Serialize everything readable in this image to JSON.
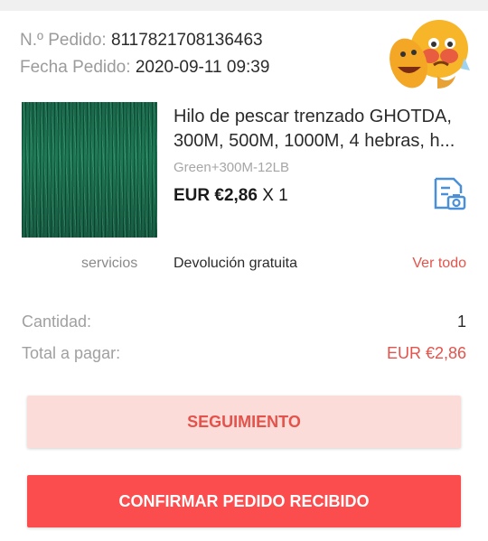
{
  "order": {
    "number_label": "N.º Pedido:",
    "number_value": "8117821708136463",
    "date_label": "Fecha Pedido:",
    "date_value": "2020-09-11 09:39"
  },
  "product": {
    "title_line1": "Hilo de pescar trenzado GHOTDA,",
    "title_line2": "300M, 500M, 1000M, 4 hebras, h...",
    "variant": "Green+300M-12LB",
    "price": "EUR €2,86",
    "quantity_text": "X 1",
    "thumbnail_icon": "fishing-line-photo",
    "action_icon": "photo-review-icon"
  },
  "services": {
    "label": "servicios",
    "value": "Devolución gratuita",
    "link": "Ver todo"
  },
  "summary": {
    "quantity_label": "Cantidad:",
    "quantity_value": "1",
    "total_label": "Total a pagar:",
    "total_value": "EUR €2,86"
  },
  "buttons": {
    "tracking": "SEGUIMIENTO",
    "confirm": "CONFIRMAR PEDIDO RECIBIDO"
  },
  "colors": {
    "accent": "#e4534b",
    "button_primary": "#fb4d4d",
    "button_secondary_bg": "#fcdcd9",
    "icon_blue": "#4a90d9"
  }
}
